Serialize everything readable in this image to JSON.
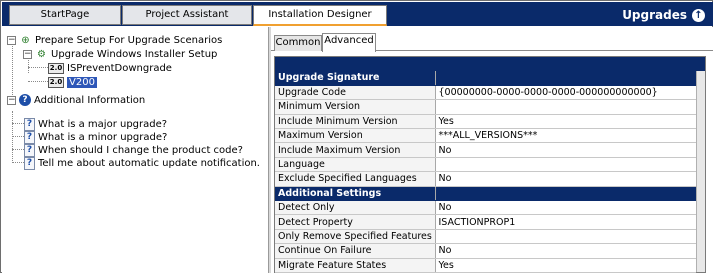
{
  "top_tabs": [
    "StartPage",
    "Project Assistant",
    "Installation Designer"
  ],
  "brand": {
    "label": "Upgrades",
    "icon": "upgrades-icon"
  },
  "tree": {
    "root1": "Prepare Setup For Upgrade Scenarios",
    "child1": "Upgrade Windows Installer Setup",
    "leaf1_badge": "2.0",
    "leaf1": "ISPreventDowngrade",
    "leaf2_badge": "2.0",
    "leaf2": "V200",
    "root2": "Additional Information",
    "questions": [
      "What is a major upgrade?",
      "What is a minor upgrade?",
      "When should I change the product code?",
      "Tell me about automatic update notification."
    ]
  },
  "sub_tabs": [
    "Common",
    "Advanced"
  ],
  "grid": {
    "section1": "Upgrade Signature",
    "rows1": [
      {
        "name": "Upgrade Code",
        "value": "{00000000-0000-0000-0000-000000000000}"
      },
      {
        "name": "Minimum Version",
        "value": ""
      },
      {
        "name": "Include Minimum Version",
        "value": "Yes"
      },
      {
        "name": "Maximum Version",
        "value": "***ALL_VERSIONS***"
      },
      {
        "name": "Include Maximum Version",
        "value": "No"
      },
      {
        "name": "Language",
        "value": ""
      },
      {
        "name": "Exclude Specified Languages",
        "value": "No"
      }
    ],
    "section2": "Additional Settings",
    "rows2": [
      {
        "name": "Detect Only",
        "value": "No"
      },
      {
        "name": "Detect Property",
        "value": "ISACTIONPROP1"
      },
      {
        "name": "Only Remove Specified Features",
        "value": ""
      },
      {
        "name": "Continue On Failure",
        "value": "No"
      },
      {
        "name": "Migrate Feature States",
        "value": "Yes"
      }
    ]
  },
  "colors": {
    "navy": "#0a2a6a",
    "selection": "#2e57b8",
    "active_tab_accent": "#f0a030"
  }
}
